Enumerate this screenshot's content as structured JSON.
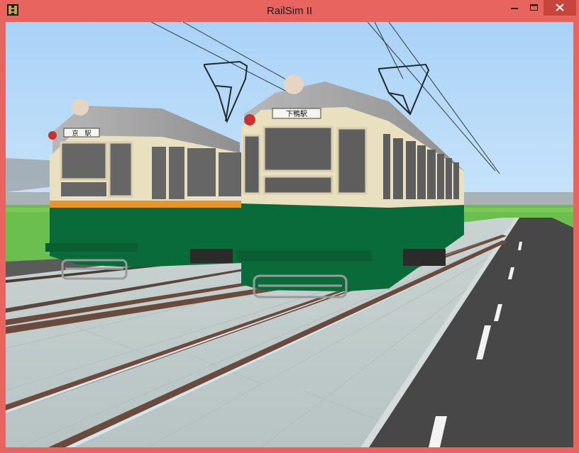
{
  "window": {
    "title": "RailSim II",
    "controls": {
      "minimize_icon": "minimize-icon",
      "maximize_icon": "maximize-icon",
      "close_icon": "close-icon"
    },
    "colors": {
      "frame": "#e8655f",
      "close_button": "#c7453d",
      "sky": "#b4d8f8",
      "grass": "#6bbf4e",
      "tram_cream": "#e9e0c0",
      "tram_green": "#0a6b3a",
      "tram_orange_stripe": "#e8962a"
    }
  },
  "scene": {
    "tram_left": {
      "destination_sign": "京　駅"
    },
    "tram_right": {
      "destination_sign": "下鴨駅"
    }
  }
}
